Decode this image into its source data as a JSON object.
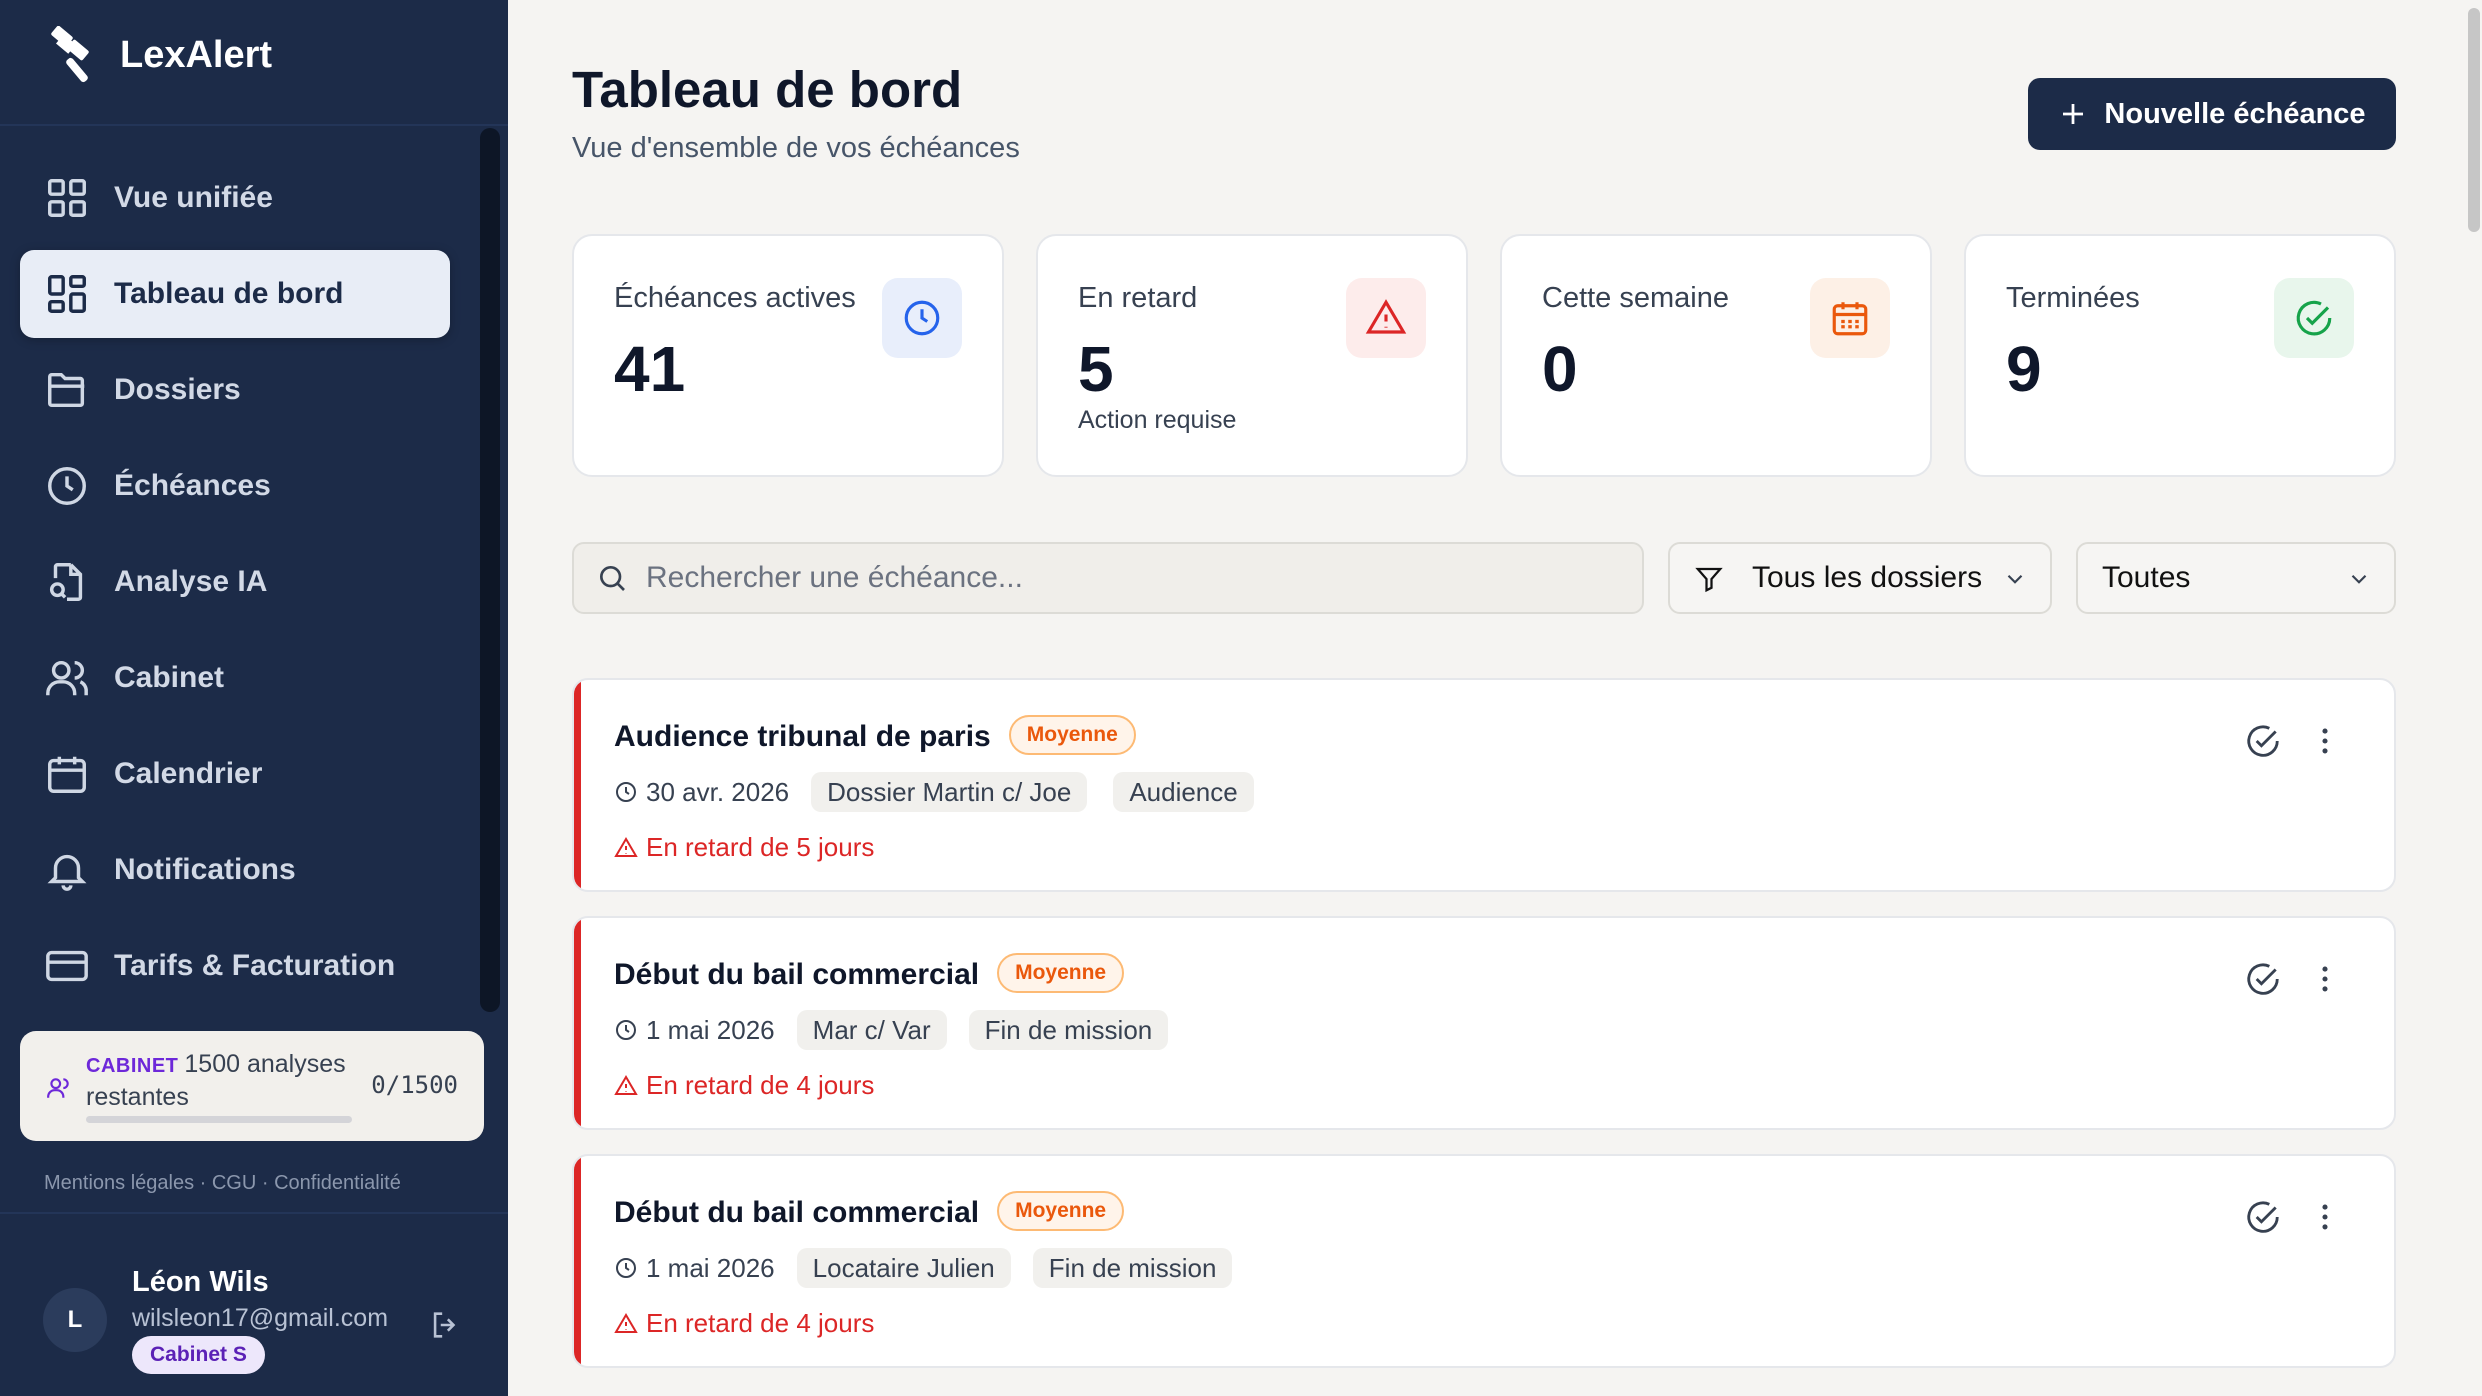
{
  "app": {
    "name": "LexAlert"
  },
  "sidebar": {
    "items": [
      {
        "label": "Vue unifiée",
        "icon": "grid-icon",
        "active": false
      },
      {
        "label": "Tableau de bord",
        "icon": "dashboard-icon",
        "active": true
      },
      {
        "label": "Dossiers",
        "icon": "folder-icon",
        "active": false
      },
      {
        "label": "Échéances",
        "icon": "clock-icon",
        "active": false
      },
      {
        "label": "Analyse IA",
        "icon": "file-search-icon",
        "active": false
      },
      {
        "label": "Cabinet",
        "icon": "users-icon",
        "active": false
      },
      {
        "label": "Calendrier",
        "icon": "calendar-icon",
        "active": false
      },
      {
        "label": "Notifications",
        "icon": "bell-icon",
        "active": false
      },
      {
        "label": "Tarifs & Facturation",
        "icon": "credit-card-icon",
        "active": false
      }
    ],
    "quota": {
      "tag": "CABINET",
      "text": "1500 analyses restantes",
      "count": "0/1500",
      "progress": 0
    },
    "legal": "Mentions légales · CGU · Confidentialité",
    "user": {
      "initial": "L",
      "name": "Léon Wils",
      "email": "wilsleon17@gmail.com",
      "plan": "Cabinet S"
    }
  },
  "header": {
    "title": "Tableau de bord",
    "subtitle": "Vue d'ensemble de vos échéances",
    "new_button": "Nouvelle échéance"
  },
  "stats": [
    {
      "label": "Échéances actives",
      "value": "41",
      "note": "",
      "icon": "clock-icon",
      "color": "#2563eb",
      "bg": "#e8eefb"
    },
    {
      "label": "En retard",
      "value": "5",
      "note": "Action requise",
      "icon": "alert-triangle-icon",
      "color": "#dc2626",
      "bg": "#fdeceb"
    },
    {
      "label": "Cette semaine",
      "value": "0",
      "note": "",
      "icon": "calendar-icon",
      "color": "#ea580c",
      "bg": "#fdf0e6"
    },
    {
      "label": "Terminées",
      "value": "9",
      "note": "",
      "icon": "check-circle-icon",
      "color": "#16a34a",
      "bg": "#e8f6ec"
    }
  ],
  "filters": {
    "search_placeholder": "Rechercher une échéance...",
    "dossier_select": "Tous les dossiers",
    "status_select": "Toutes"
  },
  "deadlines": [
    {
      "title": "Audience tribunal de paris",
      "priority": "Moyenne",
      "date": "30 avr. 2026",
      "dossier": "Dossier Martin c/ Joe",
      "type": "Audience",
      "status": "En retard de 5 jours"
    },
    {
      "title": "Début du bail commercial",
      "priority": "Moyenne",
      "date": "1 mai 2026",
      "dossier": "Mar c/ Var",
      "type": "Fin de mission",
      "status": "En retard de 4 jours"
    },
    {
      "title": "Début du bail commercial",
      "priority": "Moyenne",
      "date": "1 mai 2026",
      "dossier": "Locataire Julien",
      "type": "Fin de mission",
      "status": "En retard de 4 jours"
    }
  ],
  "colors": {
    "sidebar": "#1c2b48",
    "accent": "#1c2b48",
    "danger": "#dc2626",
    "priority": "#ea580c",
    "plan_tag": "#6d28d9"
  }
}
